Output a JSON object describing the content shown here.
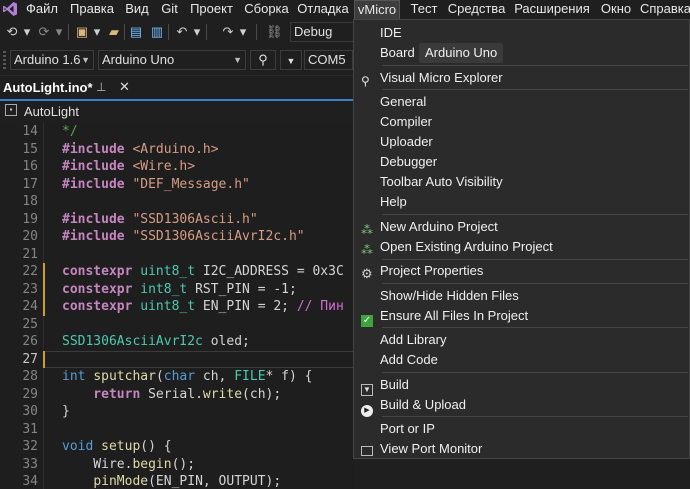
{
  "menubar": {
    "items": [
      "Файл",
      "Правка",
      "Вид",
      "Git",
      "Проект",
      "Сборка",
      "Отладка",
      "vMicro",
      "Тест",
      "Средства",
      "Расширения",
      "Окно",
      "Справка"
    ],
    "active": "vMicro"
  },
  "toolbar": {
    "config": "Debug",
    "platform": "Arduino 1.6",
    "board": "Arduino Uno",
    "port": "COM5"
  },
  "tab": {
    "label": "AutoLight.ino*"
  },
  "navbar": {
    "scope": "AutoLight"
  },
  "editor": {
    "lines": [
      {
        "n": "14",
        "tokens": [
          [
            "*/",
            "cm"
          ]
        ]
      },
      {
        "n": "15",
        "tokens": [
          [
            "#include",
            "dir"
          ],
          [
            " <Arduino.h>",
            "str"
          ]
        ]
      },
      {
        "n": "16",
        "tokens": [
          [
            "#include",
            "dir"
          ],
          [
            " <Wire.h>",
            "str"
          ]
        ]
      },
      {
        "n": "17",
        "tokens": [
          [
            "#include",
            "dir"
          ],
          [
            " \"DEF_Message.h\"",
            "str"
          ]
        ]
      },
      {
        "n": "18",
        "tokens": []
      },
      {
        "n": "19",
        "tokens": [
          [
            "#include",
            "dir"
          ],
          [
            " \"SSD1306Ascii.h\"",
            "str"
          ]
        ]
      },
      {
        "n": "20",
        "tokens": [
          [
            "#include",
            "dir"
          ],
          [
            " \"SSD1306AsciiAvrI2c.h\"",
            "str"
          ]
        ]
      },
      {
        "n": "21",
        "tokens": []
      },
      {
        "n": "22",
        "tokens": [
          [
            "constexpr",
            "purple"
          ],
          [
            " ",
            ""
          ],
          [
            "uint8_t",
            "typ"
          ],
          [
            " I2C_ADDRESS = 0x3C",
            "plain"
          ]
        ]
      },
      {
        "n": "23",
        "tokens": [
          [
            "constexpr",
            "purple"
          ],
          [
            " ",
            ""
          ],
          [
            "int8_t",
            "typ"
          ],
          [
            " RST_PIN = -1;",
            "plain"
          ]
        ]
      },
      {
        "n": "24",
        "tokens": [
          [
            "constexpr",
            "purple"
          ],
          [
            " ",
            ""
          ],
          [
            "uint8_t",
            "typ"
          ],
          [
            " EN_PIN = 2; ",
            "plain"
          ],
          [
            "// Пин",
            "pink"
          ]
        ]
      },
      {
        "n": "25",
        "tokens": []
      },
      {
        "n": "26",
        "tokens": [
          [
            "SSD1306AsciiAvrI2c",
            "typ"
          ],
          [
            " oled;",
            "plain"
          ]
        ]
      },
      {
        "n": "27",
        "tokens": []
      },
      {
        "n": "28",
        "tokens": [
          [
            "int",
            "kw"
          ],
          [
            " ",
            ""
          ],
          [
            "sputchar",
            "fn"
          ],
          [
            "(",
            "plain"
          ],
          [
            "char",
            "kw"
          ],
          [
            " ch, ",
            "plain"
          ],
          [
            "FILE",
            "typ"
          ],
          [
            "* f) {",
            "plain"
          ]
        ]
      },
      {
        "n": "29",
        "tokens": [
          [
            "    return",
            "purple"
          ],
          [
            " Serial.",
            "plain"
          ],
          [
            "write",
            "fn"
          ],
          [
            "(ch);",
            "plain"
          ]
        ]
      },
      {
        "n": "30",
        "tokens": [
          [
            "}",
            "plain"
          ]
        ]
      },
      {
        "n": "31",
        "tokens": []
      },
      {
        "n": "32",
        "tokens": [
          [
            "void",
            "kw"
          ],
          [
            " ",
            ""
          ],
          [
            "setup",
            "fn"
          ],
          [
            "() {",
            "plain"
          ]
        ]
      },
      {
        "n": "33",
        "tokens": [
          [
            "    Wire.",
            "plain"
          ],
          [
            "begin",
            "fn"
          ],
          [
            "();",
            "plain"
          ]
        ]
      },
      {
        "n": "34",
        "tokens": [
          [
            "    ",
            ""
          ],
          [
            "pinMode",
            "fn"
          ],
          [
            "(EN_PIN, OUTPUT);",
            "plain"
          ]
        ]
      }
    ]
  },
  "dropdown": {
    "items": [
      {
        "label": "IDE",
        "icon": ""
      },
      {
        "label": "Board",
        "icon": "",
        "value": "Arduino Uno"
      },
      {
        "sep": true
      },
      {
        "label": "Visual Micro Explorer",
        "icon": "search-icon"
      },
      {
        "sep": true
      },
      {
        "label": "General",
        "icon": ""
      },
      {
        "label": "Compiler",
        "icon": ""
      },
      {
        "label": "Uploader",
        "icon": ""
      },
      {
        "label": "Debugger",
        "icon": ""
      },
      {
        "label": "Toolbar Auto Visibility",
        "icon": ""
      },
      {
        "label": "Help",
        "icon": ""
      },
      {
        "sep": true
      },
      {
        "label": "New Arduino Project",
        "icon": "new-project-icon"
      },
      {
        "label": "Open Existing Arduino Project",
        "icon": "open-project-icon"
      },
      {
        "sep": true
      },
      {
        "label": "Project Properties",
        "icon": "gear-icon"
      },
      {
        "sep": true
      },
      {
        "label": "Show/Hide Hidden Files",
        "icon": ""
      },
      {
        "label": "Ensure All Files In Project",
        "icon": "checkbox-icon"
      },
      {
        "sep": true
      },
      {
        "label": "Add Library",
        "icon": ""
      },
      {
        "label": "Add Code",
        "icon": ""
      },
      {
        "sep": true
      },
      {
        "label": "Build",
        "icon": "build-icon"
      },
      {
        "label": "Build & Upload",
        "icon": "upload-icon"
      },
      {
        "sep": true
      },
      {
        "label": "Port or IP",
        "icon": ""
      },
      {
        "label": "View Port Monitor",
        "icon": "monitor-icon"
      }
    ]
  },
  "colors": {
    "accent": "#3e7fce",
    "background": "#1f1f1f",
    "menu": "#2b2b2b"
  }
}
